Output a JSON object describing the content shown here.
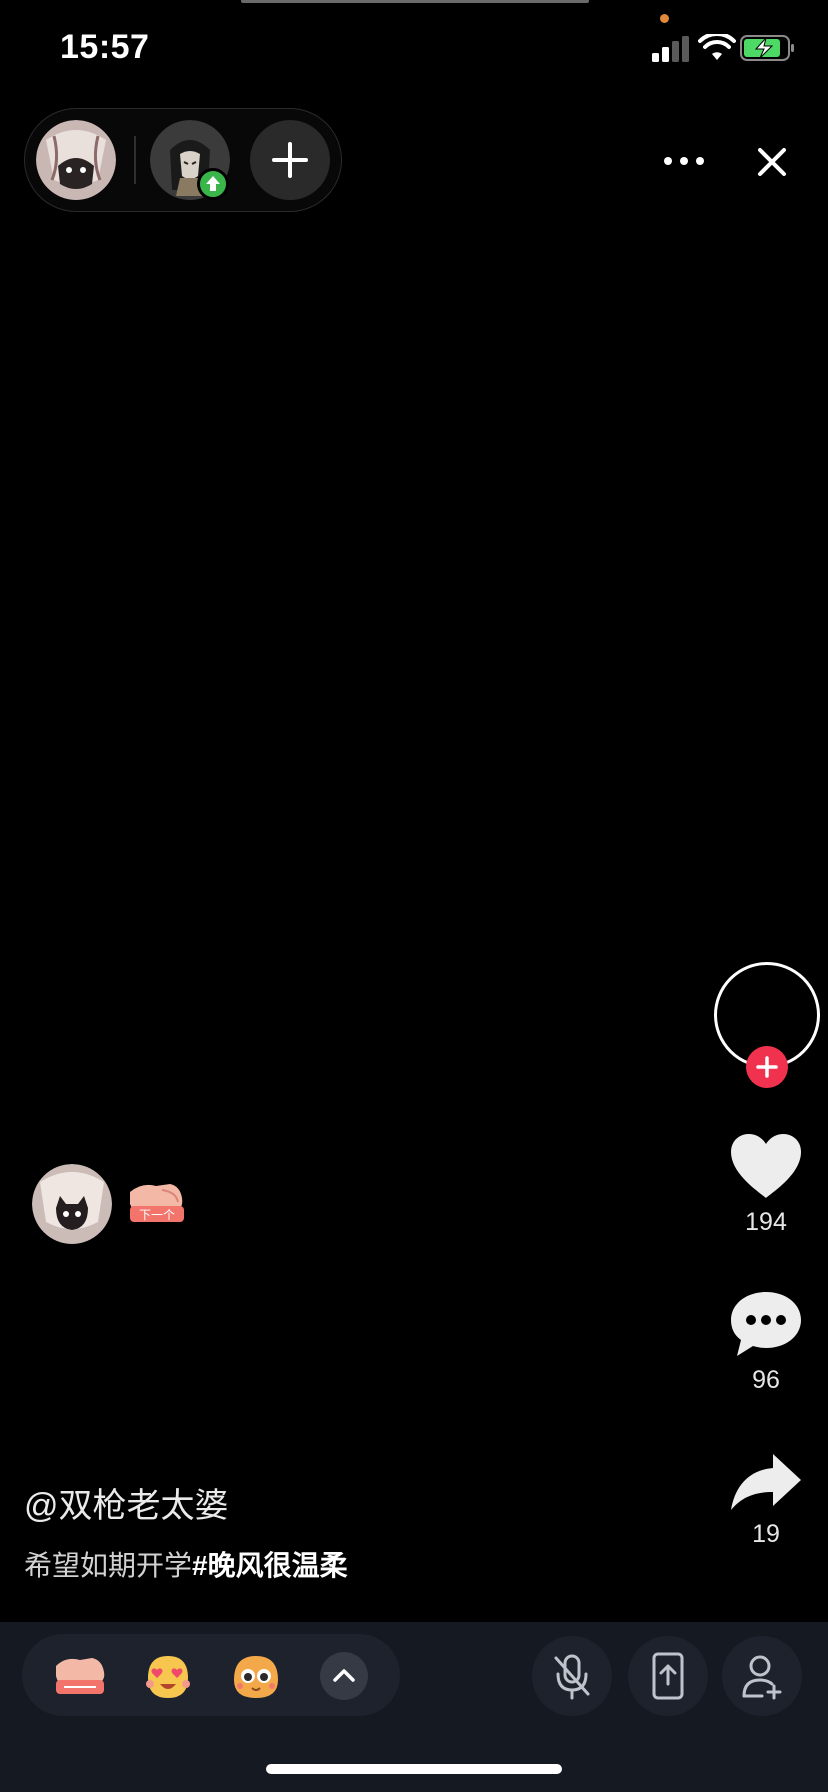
{
  "status_bar": {
    "time": "15:57"
  },
  "participants": {
    "avatars": [
      "avatar-self",
      "avatar-guest"
    ],
    "add_label": "+"
  },
  "actions": {
    "like_count": "194",
    "comment_count": "96",
    "share_count": "19"
  },
  "post": {
    "username": "@双枪老太婆",
    "caption_text": "希望如期开学",
    "caption_tag": "#晚风很温柔"
  },
  "sticker": {
    "next_text": "下一个"
  },
  "bottom_bar": {
    "reactions": [
      "next-sticker",
      "heart-eyes-emoji",
      "shy-emoji"
    ]
  },
  "colors": {
    "background": "#000000",
    "bottom_bar": "#151922",
    "accent_red": "#f0324f",
    "upload_green": "#39b54a"
  }
}
